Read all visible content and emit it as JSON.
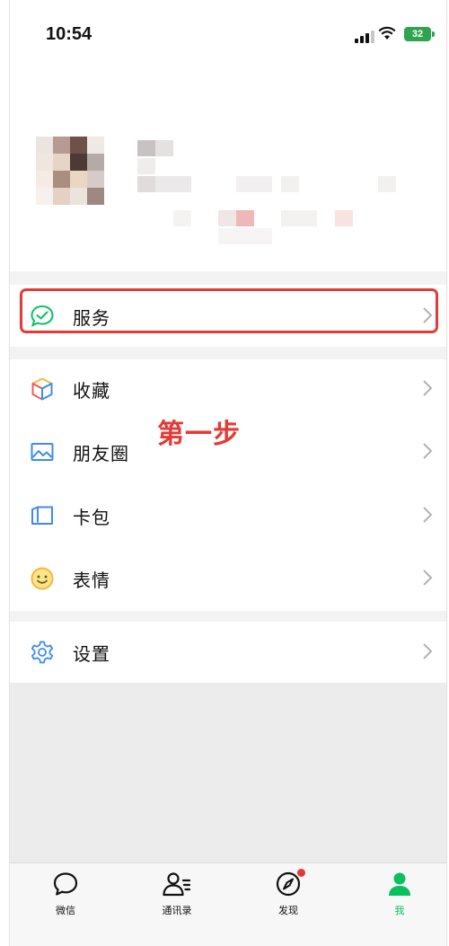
{
  "status_bar": {
    "time": "10:54",
    "battery": "32"
  },
  "menu": {
    "services": "服务",
    "favorites": "收藏",
    "moments": "朋友圈",
    "cards": "卡包",
    "stickers": "表情",
    "settings": "设置"
  },
  "annotation": "第一步",
  "tabs": [
    {
      "label": "微信"
    },
    {
      "label": "通讯录"
    },
    {
      "label": "发现"
    },
    {
      "label": "我"
    }
  ],
  "colors": {
    "accent": "#07c160",
    "highlight": "#e53935",
    "separator": "#f3f3f3"
  }
}
